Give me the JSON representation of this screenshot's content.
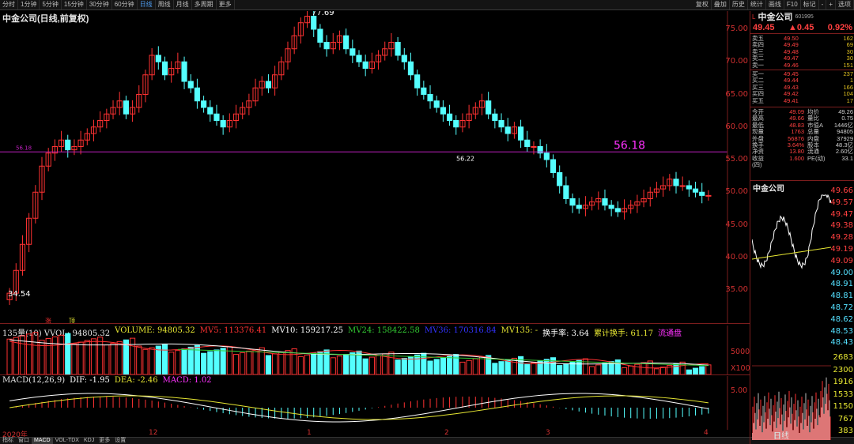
{
  "toolbar": {
    "left": [
      "分时",
      "1分钟",
      "5分钟",
      "15分钟",
      "30分钟",
      "60分钟",
      "日线",
      "周线",
      "月线",
      "多周期",
      "更多"
    ],
    "active": "日线",
    "right": [
      "叠加",
      "历史",
      "统计",
      "画线",
      "F10",
      "标记",
      "-",
      "+",
      "选项"
    ],
    "right_first": "复权"
  },
  "chart_title": "中金公司(日线,前复权)",
  "kline": {
    "high_label": "77.69",
    "low_label": "34.54",
    "hline_left_label": "56.18",
    "hline_right_label": "56.22",
    "hline_value_label": "56.18",
    "axis_ticks": [
      "75.00",
      "70.00",
      "65.00",
      "60.00",
      "55.00",
      "50.00",
      "45.00",
      "40.00",
      "35.00"
    ],
    "marker_a": "涨",
    "marker_b": "顶"
  },
  "volume_header": {
    "name": "135量(10) VVOL: 94805.32",
    "volume": "VOLUME: 94805.32",
    "mv5": "MV5: 113376.41",
    "mv10": "MV10: 159217.25",
    "mv24": "MV24: 158422.58",
    "mv36": "MV36: 170316.84",
    "mv135": "MV135: -",
    "turnover": "换手率: 3.64",
    "cum_turnover": "累计换手: 61.17",
    "float": "流通盘",
    "axis_mid": "5000",
    "axis_unit": "X100"
  },
  "macd_header": {
    "name": "MACD(12,26,9)",
    "dif": "DIF: -1.95",
    "dea": "DEA: -2.46",
    "macd": "MACD: 1.02",
    "axis": "5.00"
  },
  "dates": {
    "year": "2020年",
    "m12": "12",
    "m1": "1",
    "m2": "2",
    "m3": "3",
    "m4": "4"
  },
  "bottom_tabs": [
    "指标",
    "窗口",
    "MACD",
    "VOL-TDX",
    "KDJ",
    "更多",
    "设置"
  ],
  "bottom_active": "MACD",
  "side": {
    "flag": "L",
    "name": "中金公司",
    "code": "601995",
    "price": "49.45",
    "change": "▲0.45",
    "pct": "0.92%",
    "asks": [
      {
        "l": "卖五",
        "p": "49.50",
        "v": "162"
      },
      {
        "l": "卖四",
        "p": "49.49",
        "v": "69"
      },
      {
        "l": "卖三",
        "p": "49.48",
        "v": "30"
      },
      {
        "l": "卖二",
        "p": "49.47",
        "v": "30"
      },
      {
        "l": "卖一",
        "p": "49.46",
        "v": "151"
      }
    ],
    "bids": [
      {
        "l": "买一",
        "p": "49.45",
        "v": "237"
      },
      {
        "l": "买二",
        "p": "49.44",
        "v": "1"
      },
      {
        "l": "买三",
        "p": "49.43",
        "v": "166"
      },
      {
        "l": "买四",
        "p": "49.42",
        "v": "104"
      },
      {
        "l": "买五",
        "p": "49.41",
        "v": "17"
      }
    ],
    "stats": [
      {
        "k": "今开",
        "a": "49.09",
        "k2": "均价",
        "b": "49.26"
      },
      {
        "k": "最高",
        "a": "49.66",
        "k2": "量比",
        "b": "0.75"
      },
      {
        "k": "最低",
        "a": "48.83",
        "k2": "市值A",
        "b": "1446亿"
      },
      {
        "k": "现量",
        "a": "1763",
        "k2": "总量",
        "b": "94805"
      },
      {
        "k": "外盘",
        "a": "56876",
        "k2": "内盘",
        "b": "37929"
      },
      {
        "k": "换手",
        "a": "3.64%",
        "k2": "股本",
        "b": "48.3亿"
      },
      {
        "k": "净资",
        "a": "13.80",
        "k2": "流通",
        "b": "2.60亿"
      },
      {
        "k": "收益(四)",
        "a": "1.600",
        "k2": "PE(动)",
        "b": "33.1"
      }
    ],
    "mini_title": "中金公司",
    "mini_price_ticks": [
      "49.66",
      "49.57",
      "49.47",
      "49.38",
      "49.28",
      "49.19",
      "49.09",
      "49.00",
      "48.91",
      "48.81",
      "48.72",
      "48.62",
      "48.53",
      "48.43"
    ],
    "mini_vol_ticks": [
      "2683",
      "2300",
      "1916",
      "1533",
      "1150",
      "767",
      "383"
    ],
    "mini_label": "日线"
  },
  "colors": {
    "up": "#ff3232",
    "down": "#54ffff",
    "ma_white": "#ffffff",
    "ma_yellow": "#e6e632",
    "ma_magenta": "#ff32ff",
    "ma_green": "#32c832",
    "ma_red": "#ff3232",
    "hline": "#c020c0"
  }
}
